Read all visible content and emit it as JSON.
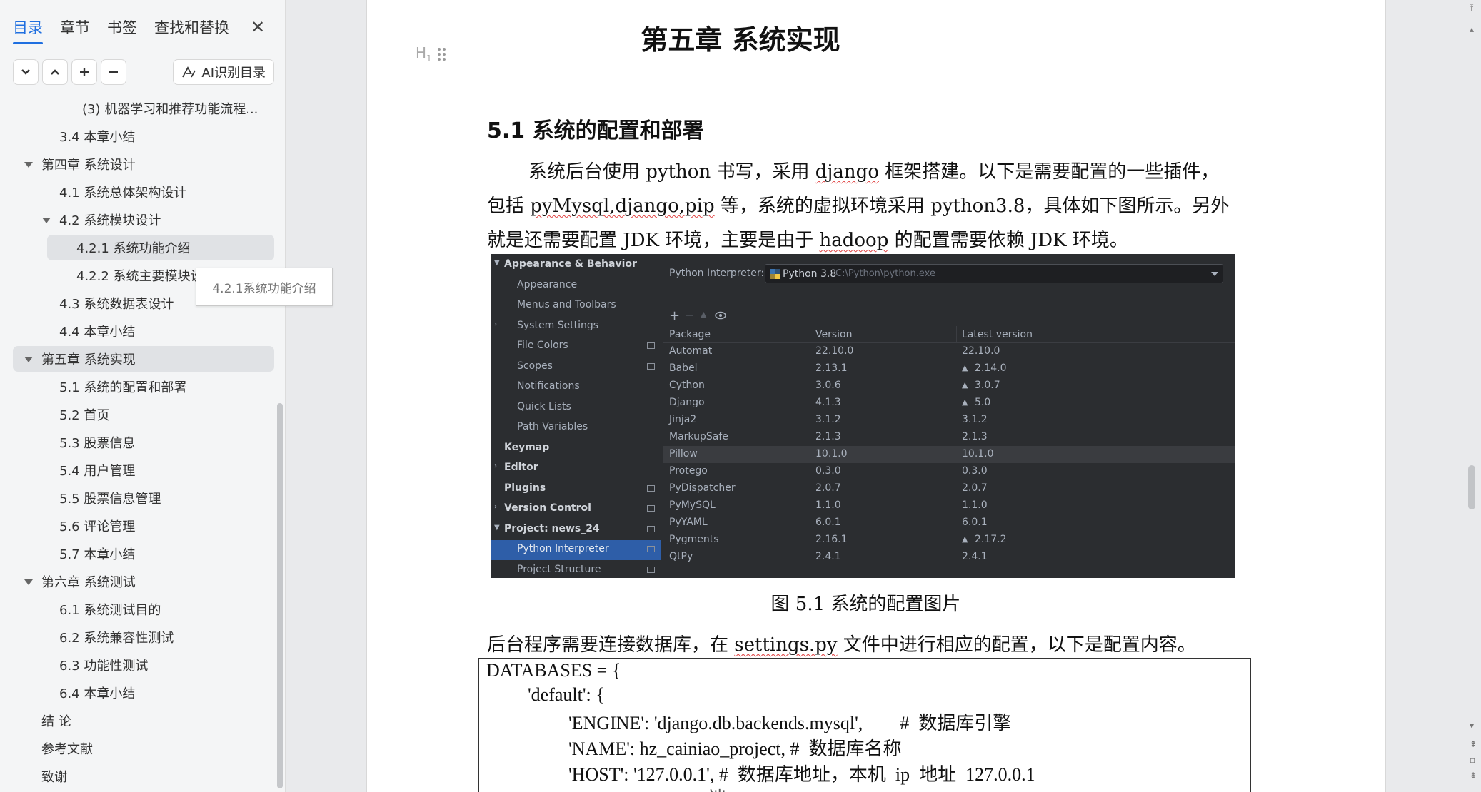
{
  "sidebar": {
    "tabs": [
      "目录",
      "章节",
      "书签",
      "查找和替换"
    ],
    "ai_button": "AI识别目录",
    "tooltip": "4.2.1系统功能介绍",
    "toc": [
      {
        "label": "(3) 机器学习和推荐功能流程...",
        "level": 3
      },
      {
        "label": "3.4 本章小结",
        "level": 2
      },
      {
        "label": "第四章  系统设计",
        "level": 1,
        "expanded": true
      },
      {
        "label": "4.1  系统总体架构设计",
        "level": 2
      },
      {
        "label": "4.2  系统模块设计",
        "level": 2,
        "expanded": true
      },
      {
        "label": "4.2.1 系统功能介绍",
        "level": 3,
        "selected": true
      },
      {
        "label": "4.2.2 系统主要模块设",
        "level": 3
      },
      {
        "label": "4.3  系统数据表设计",
        "level": 2
      },
      {
        "label": "4.4  本章小结",
        "level": 2
      },
      {
        "label": "第五章  系统实现",
        "level": 1,
        "expanded": true,
        "selected": true
      },
      {
        "label": "5.1  系统的配置和部署",
        "level": 2
      },
      {
        "label": "5.2  首页",
        "level": 2
      },
      {
        "label": "5.3  股票信息",
        "level": 2
      },
      {
        "label": "5.4  用户管理",
        "level": 2
      },
      {
        "label": "5.5  股票信息管理",
        "level": 2
      },
      {
        "label": "5.6  评论管理",
        "level": 2
      },
      {
        "label": "5.7 本章小结",
        "level": 2
      },
      {
        "label": "第六章  系统测试",
        "level": 1,
        "expanded": true
      },
      {
        "label": "6.1  系统测试目的",
        "level": 2
      },
      {
        "label": "6.2  系统兼容性测试",
        "level": 2
      },
      {
        "label": "6.3  功能性测试",
        "level": 2
      },
      {
        "label": "6.4  本章小结",
        "level": 2
      },
      {
        "label": "结    论",
        "level": 1
      },
      {
        "label": "参考文献",
        "level": 1
      },
      {
        "label": "致谢",
        "level": 1
      }
    ]
  },
  "doc": {
    "heading_marker": "H1",
    "chapter_title": "第五章  系统实现",
    "section_title": "5.1  系统的配置和部署",
    "para1_line1": "系统后台使用 python 书写，采用 ",
    "para1_django": "django",
    "para1_line1_end": " 框架搭建。以下是需要配置的一些插件，",
    "para1_line2_a": "包括 ",
    "para1_line2_u": "pyMysql,django,pip",
    "para1_line2_b": " 等，系统的虚拟环境采用 python3.8，具体如下图所示。另外",
    "para1_line3_a": "就是还需要配置 JDK 环境，主要是由于 ",
    "para1_line3_u": "hadoop",
    "para1_line3_b": " 的配置需要依赖 JDK 环境。",
    "caption": "图 5.1 系统的配置图片",
    "para2_a": "后台程序需要连接数据库，在 ",
    "para2_u": "settings.py",
    "para2_b": " 文件中进行相应的配置，以下是配置内容。",
    "code": [
      "DATABASES = {",
      "'default': {",
      "'ENGINE': 'django.db.backends.mysql',        #  数据库引擎",
      "'NAME': hz_cainiao_project, #  数据库名称",
      "'HOST': '127.0.0.1', #  数据库地址，本机  ip  地址  127.0.0.1",
      "# 端"
    ]
  },
  "ide": {
    "settings_tree": [
      {
        "label": "Appearance & Behavior",
        "bold": true,
        "arrow": "down"
      },
      {
        "label": "Appearance"
      },
      {
        "label": "Menus and Toolbars"
      },
      {
        "label": "System Settings",
        "arrow": "right"
      },
      {
        "label": "File Colors",
        "icon": true
      },
      {
        "label": "Scopes",
        "icon": true
      },
      {
        "label": "Notifications"
      },
      {
        "label": "Quick Lists"
      },
      {
        "label": "Path Variables"
      },
      {
        "label": "Keymap",
        "bold": true
      },
      {
        "label": "Editor",
        "bold": true,
        "arrow": "right"
      },
      {
        "label": "Plugins",
        "bold": true,
        "icon": true
      },
      {
        "label": "Version Control",
        "bold": true,
        "arrow": "right",
        "icon": true
      },
      {
        "label": "Project: news_24",
        "bold": true,
        "arrow": "down",
        "icon": true
      },
      {
        "label": "Python Interpreter",
        "selected": true,
        "icon": true
      },
      {
        "label": "Project Structure",
        "icon": true
      }
    ],
    "interpreter_label": "Python Interpreter:",
    "interpreter_value": "Python 3.8",
    "interpreter_path": "C:\\Python\\python.exe",
    "columns": [
      "Package",
      "Version",
      "Latest version"
    ],
    "packages": [
      [
        "Automat",
        "22.10.0",
        "22.10.0",
        false
      ],
      [
        "Babel",
        "2.13.1",
        "2.14.0",
        true
      ],
      [
        "Cython",
        "3.0.6",
        "3.0.7",
        true
      ],
      [
        "Django",
        "4.1.3",
        "5.0",
        true
      ],
      [
        "Jinja2",
        "3.1.2",
        "3.1.2",
        false
      ],
      [
        "MarkupSafe",
        "2.1.3",
        "2.1.3",
        false
      ],
      [
        "Pillow",
        "10.1.0",
        "10.1.0",
        false
      ],
      [
        "Protego",
        "0.3.0",
        "0.3.0",
        false
      ],
      [
        "PyDispatcher",
        "2.0.7",
        "2.0.7",
        false
      ],
      [
        "PyMySQL",
        "1.1.0",
        "1.1.0",
        false
      ],
      [
        "PyYAML",
        "6.0.1",
        "6.0.1",
        false
      ],
      [
        "Pygments",
        "2.16.1",
        "2.17.2",
        true
      ],
      [
        "QtPy",
        "2.4.1",
        "2.4.1",
        false
      ]
    ]
  }
}
